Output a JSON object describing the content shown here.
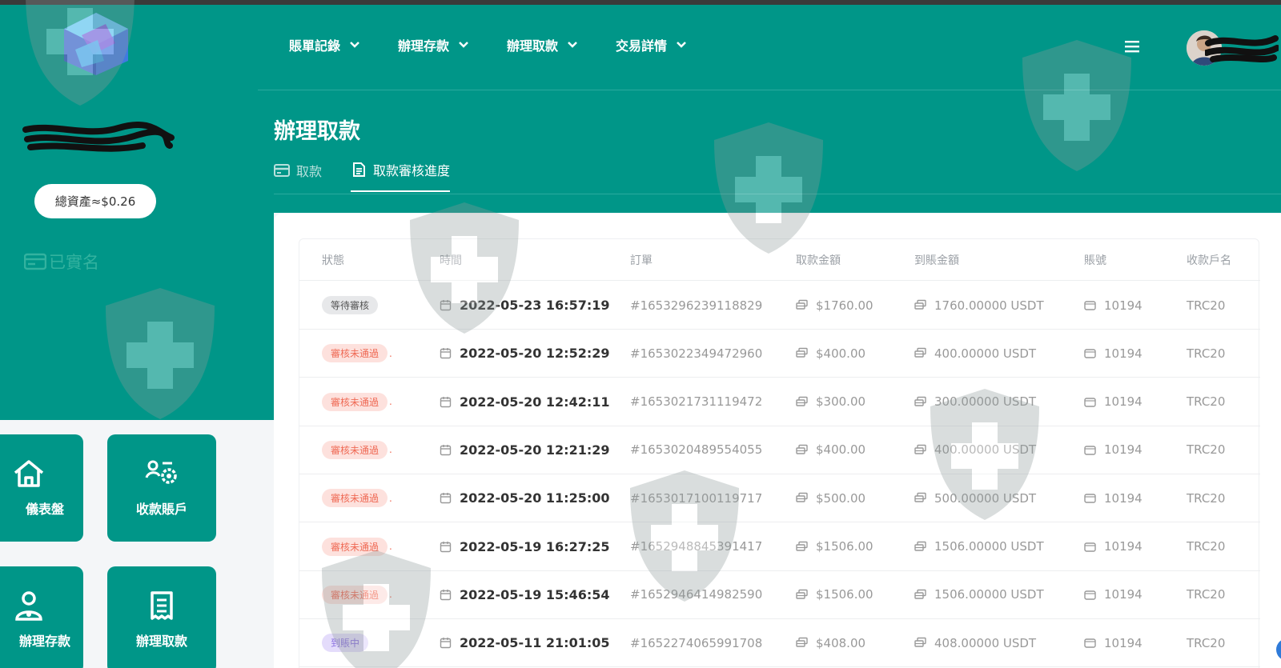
{
  "sidebar": {
    "assets_label": "總資產≈$0.26",
    "verified_label": "已實名",
    "tiles": [
      {
        "label": "儀表盤",
        "icon": "home-icon"
      },
      {
        "label": "收款賬戶",
        "icon": "users-gear-icon"
      },
      {
        "label": "辦理存款",
        "icon": "user-deposit-icon"
      },
      {
        "label": "辦理取款",
        "icon": "document-list-icon"
      }
    ]
  },
  "nav": {
    "items": [
      "賬單記錄",
      "辦理存款",
      "辦理取款",
      "交易詳情"
    ]
  },
  "page": {
    "title": "辦理取款",
    "tabs": [
      {
        "label": "取款",
        "icon": "card-icon",
        "active": false
      },
      {
        "label": "取款審核進度",
        "icon": "document-icon",
        "active": true
      }
    ]
  },
  "table": {
    "columns": [
      "狀態",
      "時間",
      "訂單",
      "取款金額",
      "到賬金額",
      "賬號",
      "收款戶名"
    ],
    "rows": [
      {
        "status": "等待審核",
        "kind": "wait",
        "time": "2022-05-23 16:57:19",
        "order": "#1653296239118829",
        "amount": "$1760.00",
        "received": "1760.00000 USDT",
        "account": "10194",
        "name": "TRC20"
      },
      {
        "status": "審核未通過",
        "kind": "rej",
        "time": "2022-05-20 12:52:29",
        "order": "#1653022349472960",
        "amount": "$400.00",
        "received": "400.00000 USDT",
        "account": "10194",
        "name": "TRC20"
      },
      {
        "status": "審核未通過",
        "kind": "rej",
        "time": "2022-05-20 12:42:11",
        "order": "#1653021731119472",
        "amount": "$300.00",
        "received": "300.00000 USDT",
        "account": "10194",
        "name": "TRC20"
      },
      {
        "status": "審核未通過",
        "kind": "rej",
        "time": "2022-05-20 12:21:29",
        "order": "#1653020489554055",
        "amount": "$400.00",
        "received": "400.00000 USDT",
        "account": "10194",
        "name": "TRC20"
      },
      {
        "status": "審核未通過",
        "kind": "rej",
        "time": "2022-05-20 11:25:00",
        "order": "#1653017100119717",
        "amount": "$500.00",
        "received": "500.00000 USDT",
        "account": "10194",
        "name": "TRC20"
      },
      {
        "status": "審核未通過",
        "kind": "rej",
        "time": "2022-05-19 16:27:25",
        "order": "#1652948845391417",
        "amount": "$1506.00",
        "received": "1506.00000 USDT",
        "account": "10194",
        "name": "TRC20"
      },
      {
        "status": "審核未通過",
        "kind": "rej",
        "time": "2022-05-19 15:46:54",
        "order": "#1652946414982590",
        "amount": "$1506.00",
        "received": "1506.00000 USDT",
        "account": "10194",
        "name": "TRC20"
      },
      {
        "status": "到賬中",
        "kind": "proc",
        "time": "2022-05-11 21:01:05",
        "order": "#1652274065991708",
        "amount": "$408.00",
        "received": "408.00000 USDT",
        "account": "10194",
        "name": "TRC20"
      }
    ]
  },
  "colors": {
    "teal": "#009688",
    "reject": "#ef6a55",
    "processing": "#8a70e0"
  }
}
